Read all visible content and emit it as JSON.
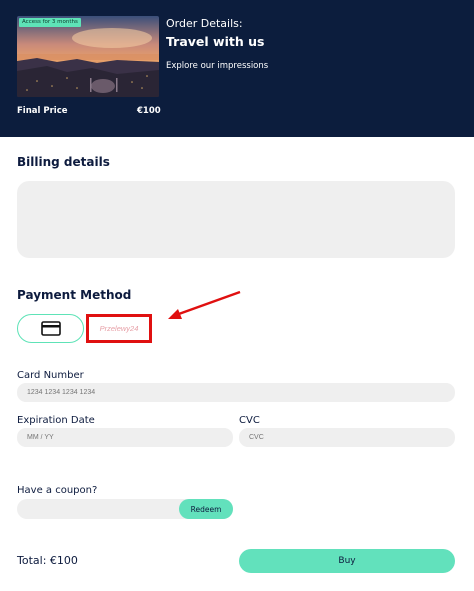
{
  "order": {
    "badge": "Access for 3 months",
    "final_price_label": "Final Price",
    "final_price_value": "€100",
    "title": "Order Details:",
    "name": "Travel with us",
    "description": "Explore our impressions"
  },
  "billing": {
    "title": "Billing details"
  },
  "payment": {
    "title": "Payment Method",
    "card_icon": "credit-card-icon",
    "p24_label": "Przelewy24",
    "annotation_color": "#e01010"
  },
  "form": {
    "card_number_label": "Card Number",
    "card_number_placeholder": "1234 1234 1234 1234",
    "expiration_label": "Expiration Date",
    "expiration_placeholder": "MM / YY",
    "cvc_label": "CVC",
    "cvc_placeholder": "CVC",
    "coupon_label": "Have a coupon?",
    "coupon_value": "",
    "redeem_label": "Redeem"
  },
  "footer": {
    "total": "Total: €100",
    "buy_label": "Buy"
  },
  "colors": {
    "header_bg": "#0c1d3d",
    "accent": "#62e1bc",
    "field_bg": "#efefef"
  }
}
